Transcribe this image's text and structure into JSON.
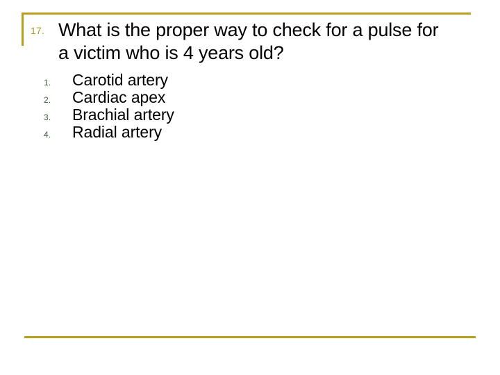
{
  "slide": {
    "accent_color": "#b8a01e",
    "number_color": "#b5951e",
    "option_number_color": "#3c5a3c",
    "text_color": "#000000",
    "background_color": "#ffffff",
    "question": {
      "number": "17.",
      "line1": "What is the proper way to check for a",
      "line2": "pulse for a victim who is 4 years old?",
      "full_text": "What is the proper way to check for a pulse for a victim who is 4 years old?"
    },
    "options": [
      {
        "number": "1.",
        "label": "Carotid artery"
      },
      {
        "number": "2.",
        "label": "Cardiac apex"
      },
      {
        "number": "3.",
        "label": "Brachial artery"
      },
      {
        "number": "4.",
        "label": "Radial artery"
      }
    ]
  }
}
